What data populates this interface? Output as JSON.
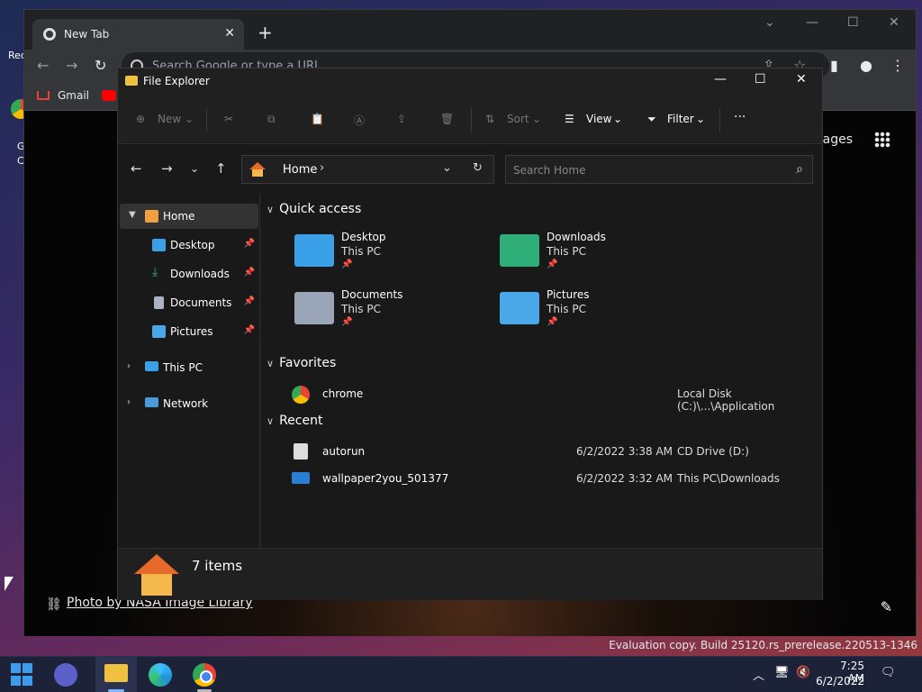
{
  "desktop": {
    "icon1_label": "Rec",
    "icon2_label_1": "G",
    "icon2_label_2": "C",
    "evaluation": "Evaluation copy. Build 25120.rs_prerelease.220513-1346"
  },
  "chrome": {
    "tab_title": "New Tab",
    "omnibox_placeholder": "Search Google or type a URL",
    "bookmarks": [
      "Gmail"
    ],
    "images_link": "Images",
    "photo_credit": "Photo by NASA Image Library"
  },
  "explorer": {
    "title": "File Explorer",
    "commands": {
      "new": "New",
      "sort": "Sort",
      "view": "View",
      "filter": "Filter",
      "more": "···"
    },
    "address": {
      "crumb": "Home",
      "search_placeholder": "Search Home"
    },
    "nav": {
      "home": "Home",
      "desktop": "Desktop",
      "downloads": "Downloads",
      "documents": "Documents",
      "pictures": "Pictures",
      "this_pc": "This PC",
      "network": "Network"
    },
    "groups": {
      "quick_access": "Quick access",
      "favorites": "Favorites",
      "recent": "Recent"
    },
    "quick_access": [
      {
        "name": "Desktop",
        "location": "This PC",
        "color": "#3aa0e8"
      },
      {
        "name": "Downloads",
        "location": "This PC",
        "color": "#2fae7a"
      },
      {
        "name": "Documents",
        "location": "This PC",
        "color": "#9aa6b8"
      },
      {
        "name": "Pictures",
        "location": "This PC",
        "color": "#4aa8e8"
      }
    ],
    "favorites": [
      {
        "name": "chrome",
        "date": "",
        "location": "Local Disk (C:)\\...\\Application"
      }
    ],
    "recent": [
      {
        "name": "autorun",
        "date": "6/2/2022 3:38 AM",
        "location": "CD Drive (D:)"
      },
      {
        "name": "wallpaper2you_501377",
        "date": "6/2/2022 3:32 AM",
        "location": "This PC\\Downloads"
      }
    ],
    "status": "7 items"
  },
  "taskbar": {
    "time": "7:25 AM",
    "date": "6/2/2022"
  }
}
